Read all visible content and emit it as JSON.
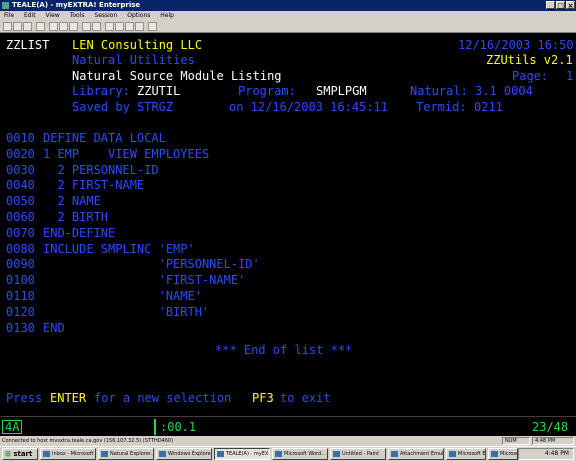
{
  "window": {
    "title": "TEALE(A) - myEXTRA! Enterprise",
    "menu": [
      "File",
      "Edit",
      "View",
      "Tools",
      "Session",
      "Options",
      "Help"
    ],
    "toolbar_icons": [
      "new-icon",
      "open-icon",
      "save-icon",
      "print-icon",
      "cut-icon",
      "copy-icon",
      "paste-icon",
      "send-icon",
      "receive-icon",
      "macro-icon",
      "settings-icon",
      "keyboard-icon",
      "font-icon",
      "help-icon"
    ]
  },
  "screen": {
    "header": {
      "program_id": "ZZLIST",
      "company": "LEN Consulting LLC",
      "datetime": "12/16/2003 16:50",
      "subtitle": "Natural Utilities",
      "version": "ZZUtils v2.1",
      "title": "Natural Source Module Listing",
      "page_label": "Page:",
      "page_num": "1",
      "library_label": "Library:",
      "library": "ZZUTIL",
      "program_label": "Program:",
      "program": "SMPLPGM",
      "natural_label": "Natural:",
      "natural": "3.1 0004",
      "saved_label": "Saved by",
      "saved_by": "STRGZ",
      "saved_on": "on 12/16/2003 16:45:11",
      "termid_label": "Termid:",
      "termid": "0211"
    },
    "source": [
      {
        "num": "0010",
        "text": "DEFINE DATA LOCAL"
      },
      {
        "num": "0020",
        "text": "1 EMP    VIEW EMPLOYEES"
      },
      {
        "num": "0030",
        "text": "  2 PERSONNEL-ID"
      },
      {
        "num": "0040",
        "text": "  2 FIRST-NAME"
      },
      {
        "num": "0050",
        "text": "  2 NAME"
      },
      {
        "num": "0060",
        "text": "  2 BIRTH"
      },
      {
        "num": "0070",
        "text": "END-DEFINE"
      },
      {
        "num": "0080",
        "text": "INCLUDE SMPLINC 'EMP'"
      },
      {
        "num": "0090",
        "text": "                'PERSONNEL-ID'"
      },
      {
        "num": "0100",
        "text": "                'FIRST-NAME'"
      },
      {
        "num": "0110",
        "text": "                'NAME'"
      },
      {
        "num": "0120",
        "text": "                'BIRTH'"
      },
      {
        "num": "0130",
        "text": "END"
      }
    ],
    "end_of_list": "*** End of list ***",
    "footer": {
      "press": "Press",
      "enter": "ENTER",
      "mid": "for a new selection",
      "pf3": "PF3",
      "exit": "to exit"
    }
  },
  "oia": {
    "indicator": "4",
    "session": "A",
    "timer": ":00.1",
    "cursor": "23/48"
  },
  "connection": {
    "text": "Connected to host mvsxtra.teale.ca.gov (156.107.32.5) (STTHD460)",
    "panels": [
      "NUM",
      "4:48 PM"
    ]
  },
  "taskbar": {
    "start": "start",
    "items": [
      "Inbox - Microsoft Outl...",
      "Natural Explorer...",
      "Windows Explorer",
      "TEALE(A) - myEX...",
      "Microsoft Word...",
      "Untitled - Paint",
      "Attachment Emula...",
      "Microsoft Excel",
      "Microsoft Access"
    ],
    "active_index": 3,
    "clock": "4:48 PM"
  }
}
